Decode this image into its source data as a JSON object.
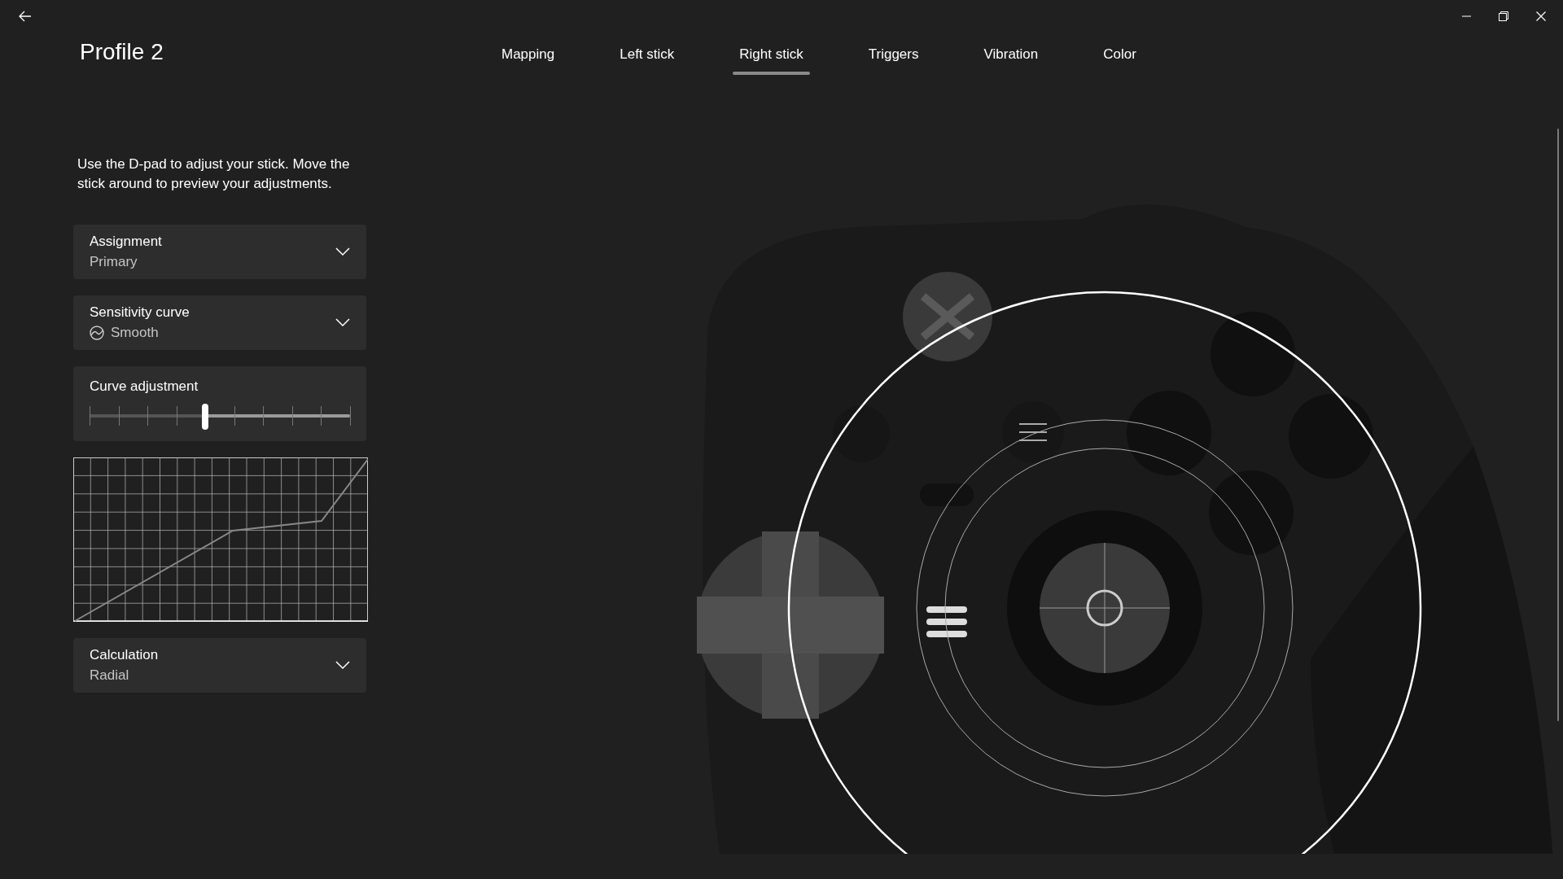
{
  "title": "Profile 2",
  "tabs": [
    {
      "label": "Mapping",
      "selected": false
    },
    {
      "label": "Left stick",
      "selected": false
    },
    {
      "label": "Right stick",
      "selected": true
    },
    {
      "label": "Triggers",
      "selected": false
    },
    {
      "label": "Vibration",
      "selected": false
    },
    {
      "label": "Color",
      "selected": false
    }
  ],
  "description": "Use the D-pad to adjust your stick. Move the stick around to preview your adjustments.",
  "settings": [
    {
      "kind": "dropdown",
      "label": "Assignment",
      "value": "Primary",
      "has_icon": false
    },
    {
      "kind": "dropdown",
      "label": "Sensitivity curve",
      "value": "Smooth",
      "has_icon": true
    },
    {
      "kind": "slider",
      "label": "Curve adjustment",
      "level": 0.444
    },
    {
      "kind": "graph"
    },
    {
      "kind": "dropdown",
      "label": "Calculation",
      "value": "Radial",
      "has_icon": false
    }
  ]
}
